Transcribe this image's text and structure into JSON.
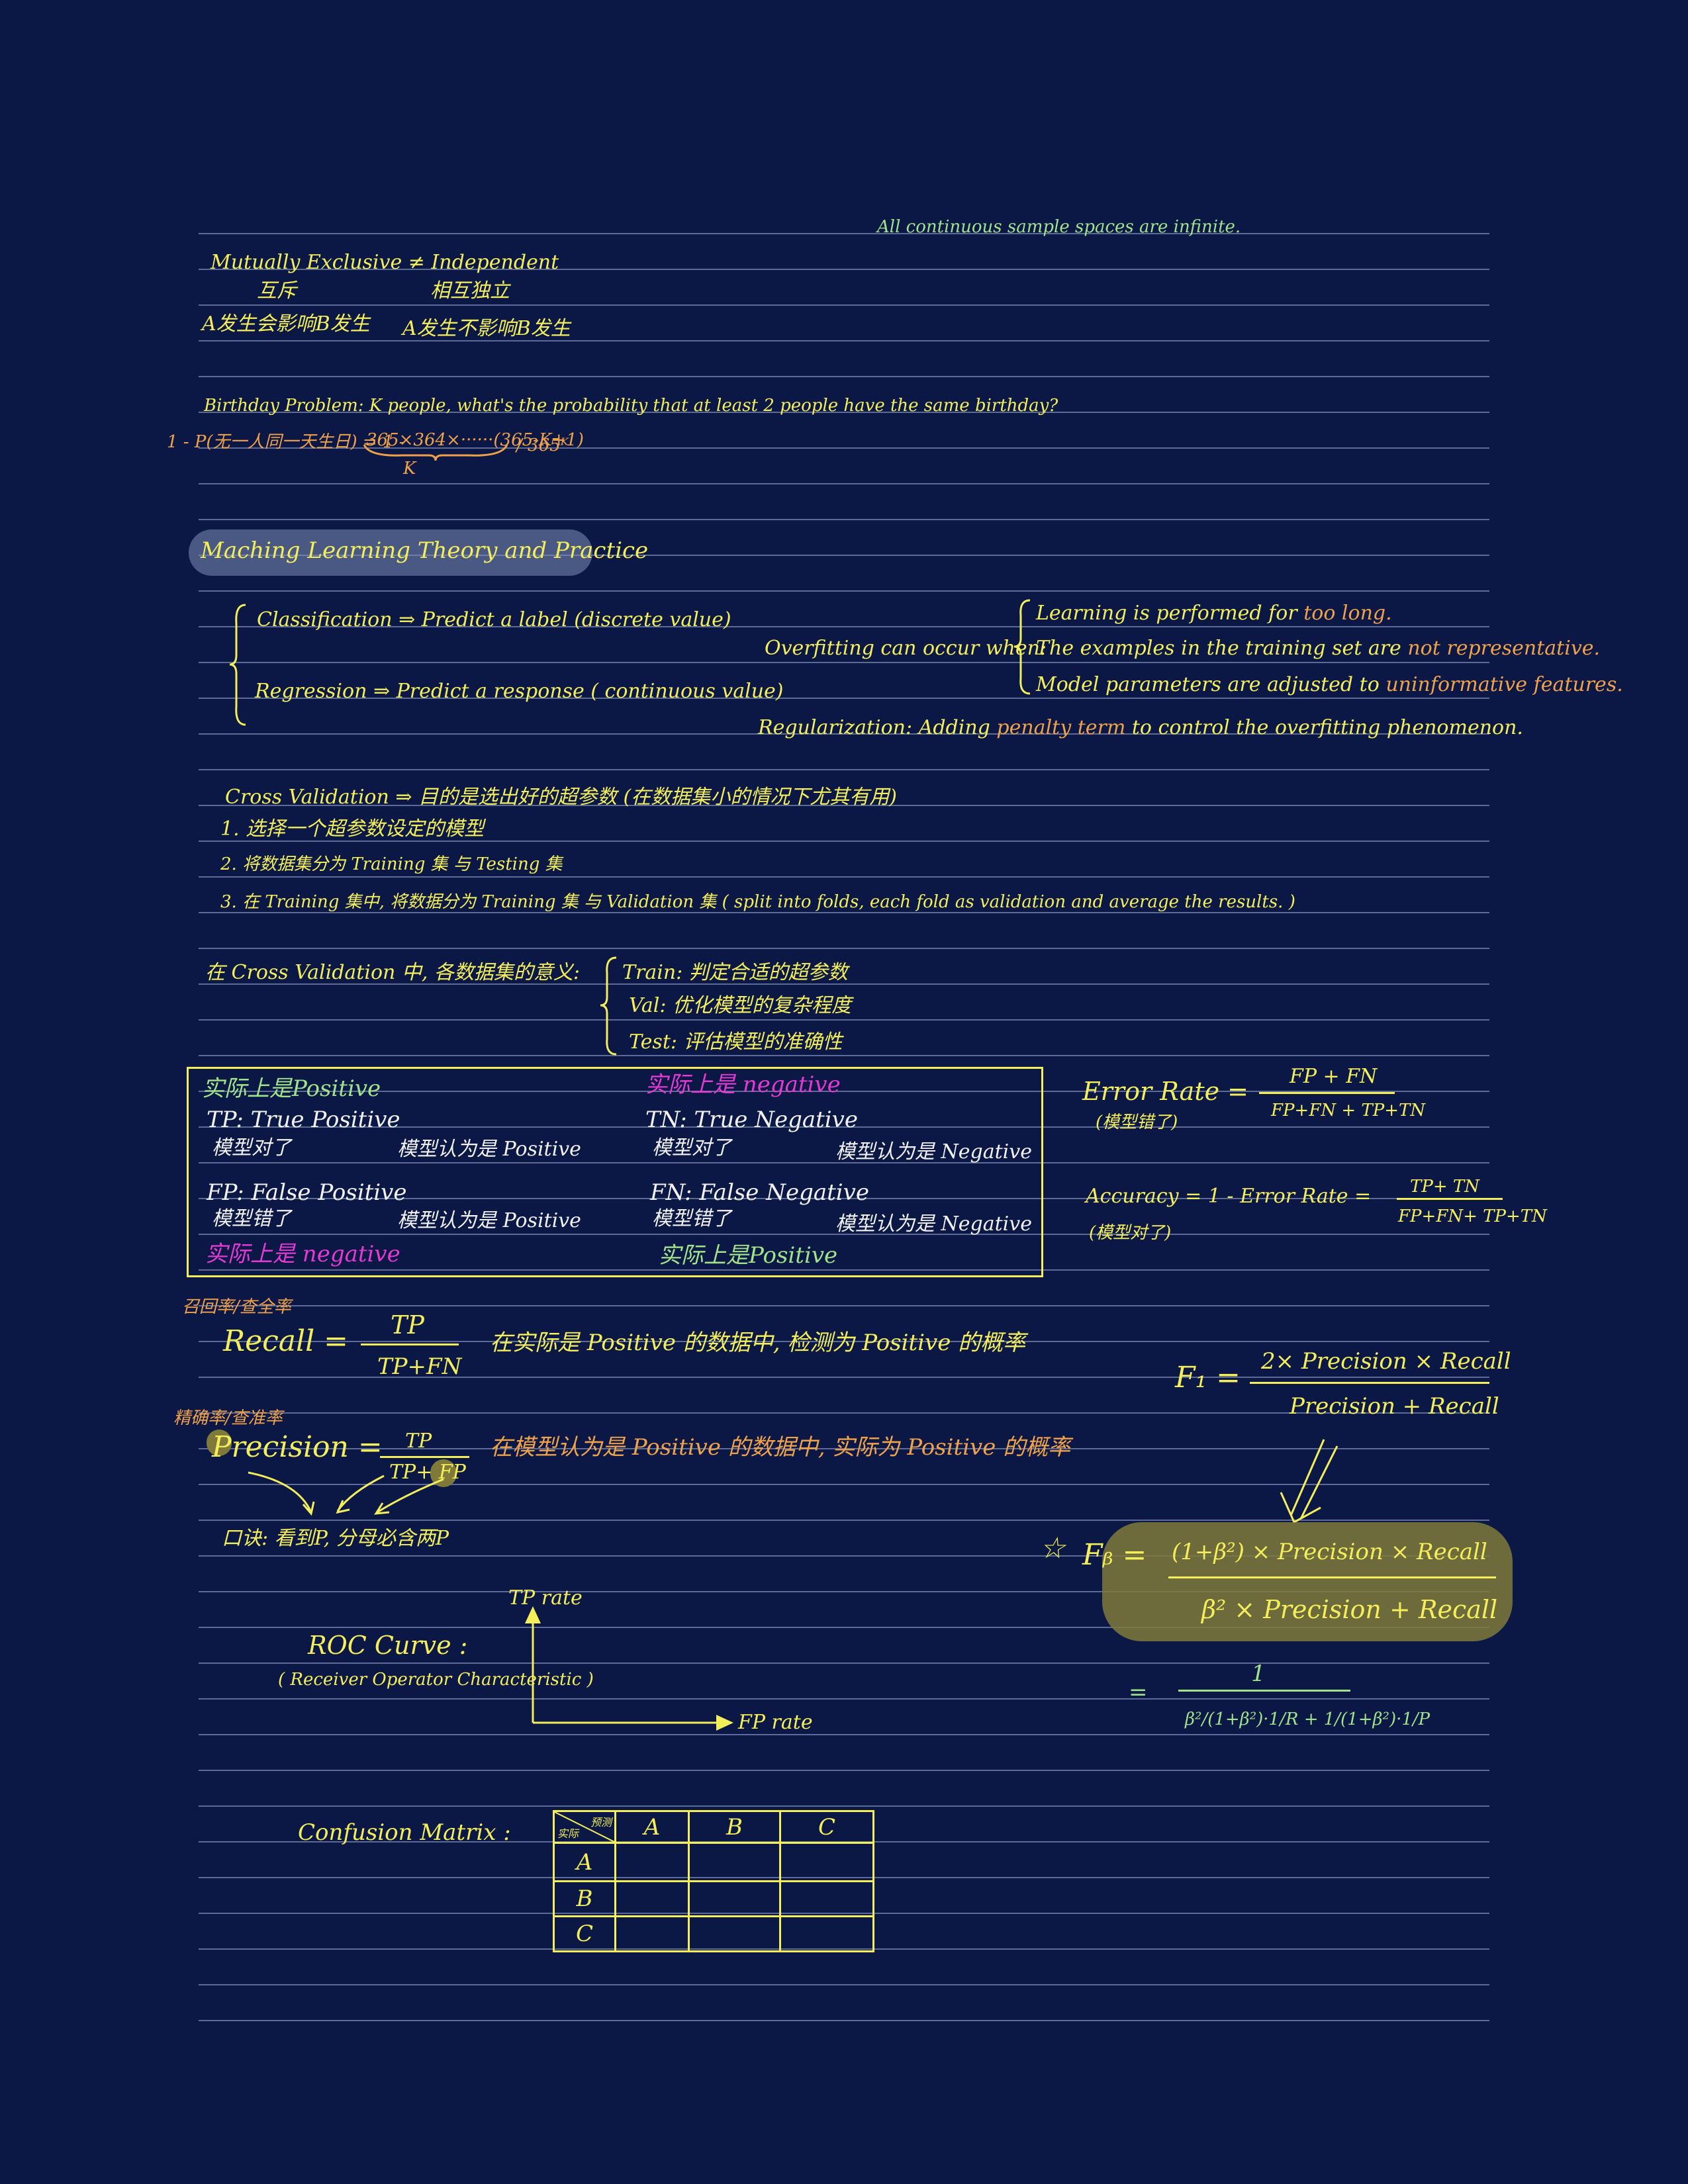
{
  "notes": {
    "continuous_note": "All continuous sample spaces are infinite.",
    "mutex_en": "Mutually Exclusive ≠ Independent",
    "mutex_zh": "互斥",
    "indep_zh": "相互独立",
    "mutex_desc": "A发生会影响B发生",
    "indep_desc": "A发生不影响B发生",
    "birthday_problem": "Birthday Problem: K people, what's the probability that at least 2 people have the same birthday?",
    "birthday_formula_left": "1 - P(无一人同一天生日) = 1 -",
    "birthday_formula_num": "365×364×······(365-K+1)",
    "birthday_formula_den": "/ 365ᴷ",
    "birthday_k": "K",
    "section_title": "Maching Learning Theory and Practice",
    "classification": "Classification ⇒ Predict a label (discrete value)",
    "regression": "Regression ⇒ Predict a response ( continuous value)",
    "overfit_lead": "Overfitting can occur when:",
    "overfit_1a": "Learning is performed for",
    "overfit_1b": "too long.",
    "overfit_2a": "The examples in the training set are",
    "overfit_2b": "not",
    "overfit_2c": "representative.",
    "overfit_3a": "Model parameters are adjusted to",
    "overfit_3b": "uninformative features.",
    "reg_a": "Regularization: Adding",
    "reg_b": "penalty term",
    "reg_c": "to control the overfitting phenomenon.",
    "cv_title": "Cross Validation ⇒ 目的是选出好的超参数 (在数据集小的情况下尤其有用)",
    "cv_1": "1. 选择一个超参数设定的模型",
    "cv_2": "2. 将数据集分为 Training 集 与 Testing 集",
    "cv_3": "3. 在 Training 集中, 将数据分为 Training 集 与 Validation 集 ( split into folds, each fold as validation and average the results. )",
    "cv_meaning": "在 Cross Validation 中, 各数据集的意义:",
    "cv_train": "Train: 判定合适的超参数",
    "cv_val": "Val: 优化模型的复杂程度",
    "cv_test": "Test: 评估模型的准确性"
  },
  "confusion_box": {
    "actual_pos": "实际上是Positive",
    "actual_neg": "实际上是 negative",
    "tp": "TP: True Positive",
    "tp_sub1": "模型对了",
    "tp_sub2": "模型认为是 Positive",
    "tn": "TN: True Negative",
    "tn_sub1": "模型对了",
    "tn_sub2": "模型认为是 Negative",
    "fp": "FP: False Positive",
    "fp_sub1": "模型错了",
    "fp_sub2": "模型认为是 Positive",
    "fn": "FN: False Negative",
    "fn_sub1": "模型错了",
    "fn_sub2": "模型认为是 Negative",
    "actual_neg2": "实际上是 negative",
    "actual_pos2": "实际上是Positive"
  },
  "metrics": {
    "error_rate": "Error Rate =",
    "error_num": "FP + FN",
    "error_den": "FP+FN + TP+TN",
    "error_note": "(模型错了)",
    "accuracy": "Accuracy = 1 - Error Rate =",
    "acc_num": "TP+ TN",
    "acc_den": "FP+FN+ TP+TN",
    "acc_note": "(模型对了)",
    "recall_zh": "召回率/查全率",
    "recall": "Recall =",
    "recall_num": "TP",
    "recall_den": "TP+FN",
    "recall_desc": "在实际是 Positive 的数据中, 检测为 Positive 的概率",
    "precision_zh": "精确率/查准率",
    "precision": "Precision =",
    "precision_num": "TP",
    "precision_den": "TP+ FP",
    "precision_desc": "在模型认为是 Positive 的数据中, 实际为 Positive 的概率",
    "mnemonic": "口诀: 看到P, 分母必含两P",
    "f1": "F₁ =",
    "f1_num": "2× Precision × Recall",
    "f1_den": "Precision + Recall",
    "star": "☆",
    "fbeta": "Fᵦ =",
    "fbeta_num": "(1+β²) × Precision × Recall",
    "fbeta_den": "β² × Precision + Recall",
    "fbeta_eq": "=",
    "fbeta_num2": "1",
    "fbeta_den2": "β²/(1+β²)·1/R + 1/(1+β²)·1/P"
  },
  "roc": {
    "title": "ROC Curve :",
    "subtitle": "( Receiver Operator Characteristic )",
    "y_axis": "TP rate",
    "x_axis": "FP rate"
  },
  "confusion_matrix": {
    "title": "Confusion Matrix :",
    "corner_pred": "预测",
    "corner_actual": "实际",
    "cols": [
      "A",
      "B",
      "C"
    ],
    "rows": [
      "A",
      "B",
      "C"
    ]
  },
  "colors": {
    "background": "#0b1845",
    "ink_yellow": "#f3ee5a",
    "ink_orange": "#f0a24a",
    "ink_green": "#9fe38a",
    "ink_magenta": "#e23ad2",
    "ink_white": "#f2f2f2",
    "highlight_blue": "#8090b8",
    "highlight_olive": "#7f7a3a",
    "rule_line": "#5b6b94"
  }
}
